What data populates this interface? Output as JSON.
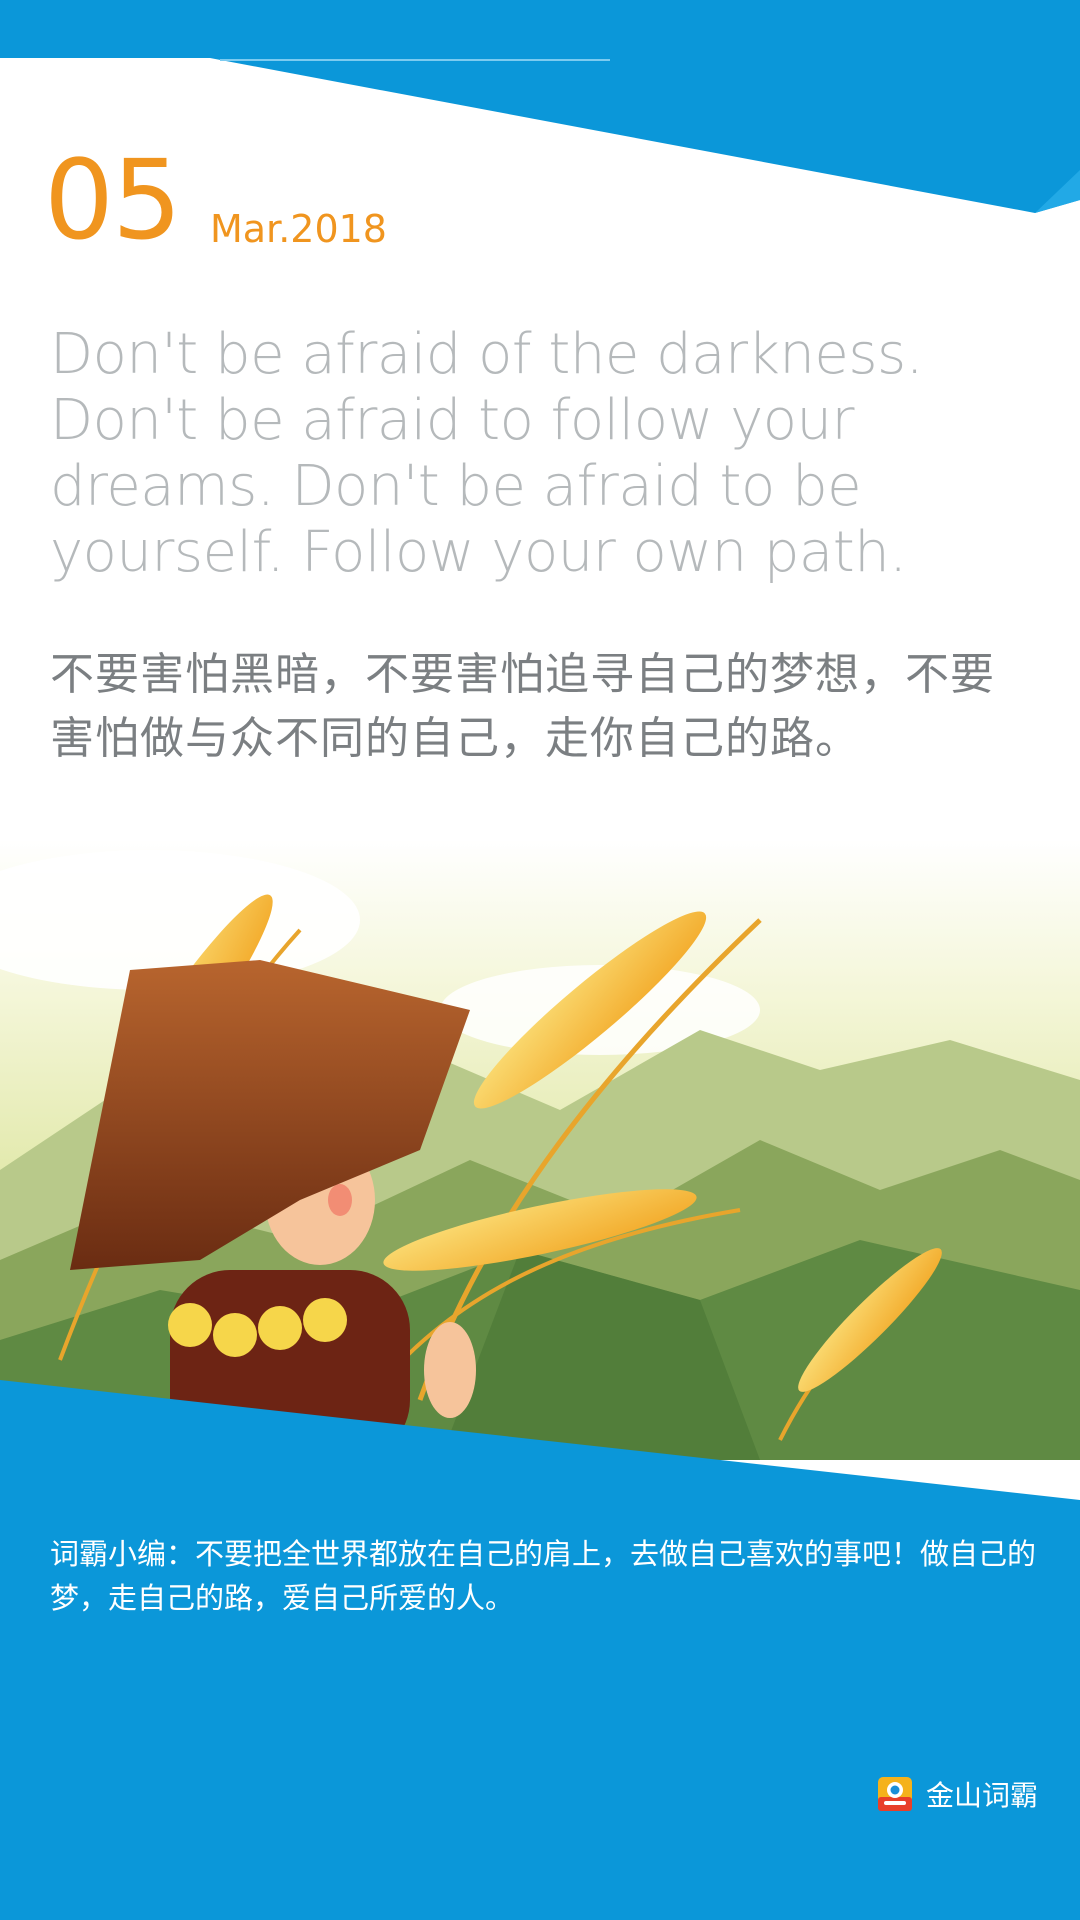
{
  "date": {
    "day": "05",
    "month_year": "Mar.2018"
  },
  "quote": {
    "english": "Don't be afraid of the darkness. Don't be afraid to follow your dreams. Don't be afraid to be yourself. Follow your own path.",
    "chinese": "不要害怕黑暗，不要害怕追寻自己的梦想，不要害怕做与众不同的自己，走你自己的路。"
  },
  "editor_note": "词霸小编：不要把全世界都放在自己的肩上，去做自己喜欢的事吧！做自己的梦，走自己的路，爱自己所爱的人。",
  "brand": {
    "name": "金山词霸",
    "logo_icon": "kingsoft-powerword-logo-icon"
  },
  "colors": {
    "accent_blue": "#0b97d9",
    "date_orange": "#f0951f",
    "english_text": "#b5b9bb",
    "chinese_text": "#7b7f82"
  }
}
